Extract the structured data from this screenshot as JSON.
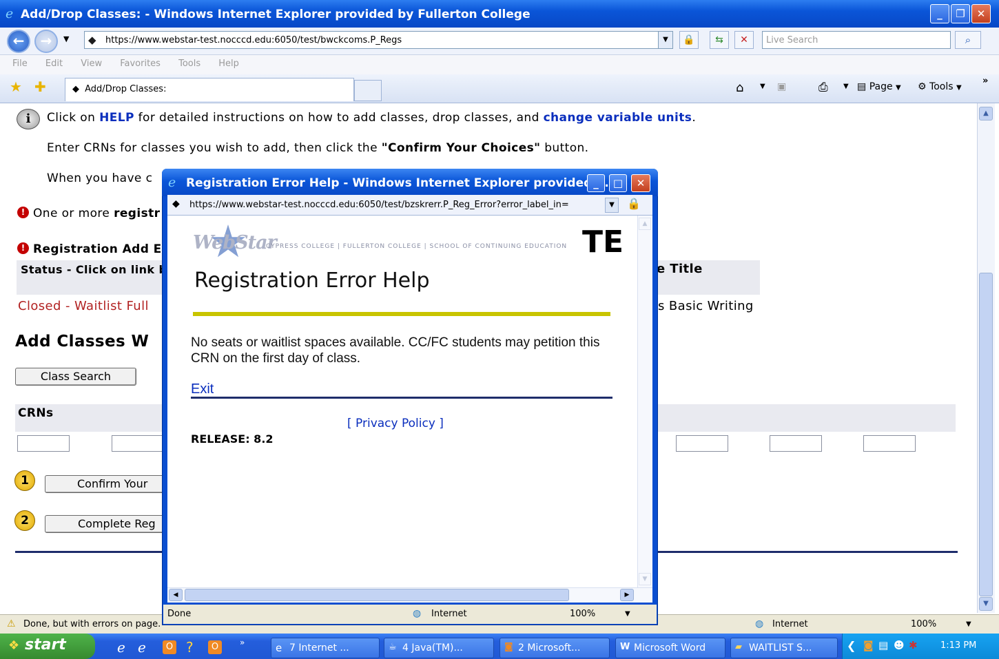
{
  "main_window": {
    "title": "Add/Drop Classes: - Windows Internet Explorer provided by Fullerton College",
    "url": "https://www.webstar-test.nocccd.edu:6050/test/bwckcoms.P_Regs",
    "search_placeholder": "Live Search",
    "menu": [
      "File",
      "Edit",
      "View",
      "Favorites",
      "Tools",
      "Help"
    ],
    "tab_label": "Add/Drop Classes:",
    "command_bar": {
      "page": "Page",
      "tools": "Tools"
    },
    "status_text": "Done, but with errors on page.",
    "zone": "Internet",
    "zoom": "100%"
  },
  "page": {
    "help_line": {
      "before": "Click on ",
      "help": "HELP",
      "middle": " for detailed instructions on how to add classes, drop classes, and ",
      "link": "change variable units",
      "after": "."
    },
    "instr1": {
      "before": "Enter CRNs for classes you wish to add, then click the ",
      "bold": "\"Confirm Your Choices\"",
      "after": " button."
    },
    "instr2": "When you have c",
    "error_line": {
      "before": "One or more ",
      "bold": "registr"
    },
    "reg_add_errors": "Registration Add E",
    "table_header_status": "Status - Click on link b",
    "table_header_title": "e Title",
    "row_status": "Closed - Waitlist Full",
    "row_title": "s Basic Writing",
    "add_classes_heading": "Add Classes W",
    "class_search_button": "Class Search",
    "crns_label": "CRNs",
    "step1_number": "1",
    "step1_button": "Confirm Your",
    "step2_number": "2",
    "step2_button": "Complete Reg"
  },
  "popup": {
    "title": "Registration Error Help - Windows Internet Explorer provided b...",
    "url": "https://www.webstar-test.nocccd.edu:6050/test/bzskrerr.P_Reg_Error?error_label_in=",
    "logo_text": "WebStar",
    "college_line": "CYPRESS COLLEGE | FULLERTON COLLEGE | SCHOOL OF CONTINUING EDUCATION",
    "env_badge": "TE",
    "heading": "Registration Error Help",
    "message": "No seats or waitlist spaces available. CC/FC students may petition this CRN on the first day of class.",
    "exit_link": "Exit",
    "privacy_link": "[ Privacy Policy ]",
    "release": "RELEASE: 8.2",
    "status_text": "Done",
    "zone": "Internet",
    "zoom": "100%"
  },
  "taskbar": {
    "start": "start",
    "tasks": [
      "7 Internet ...",
      "4 Java(TM)...",
      "2 Microsoft...",
      "Microsoft Word",
      "WAITLIST S..."
    ],
    "clock": "1:13 PM"
  }
}
